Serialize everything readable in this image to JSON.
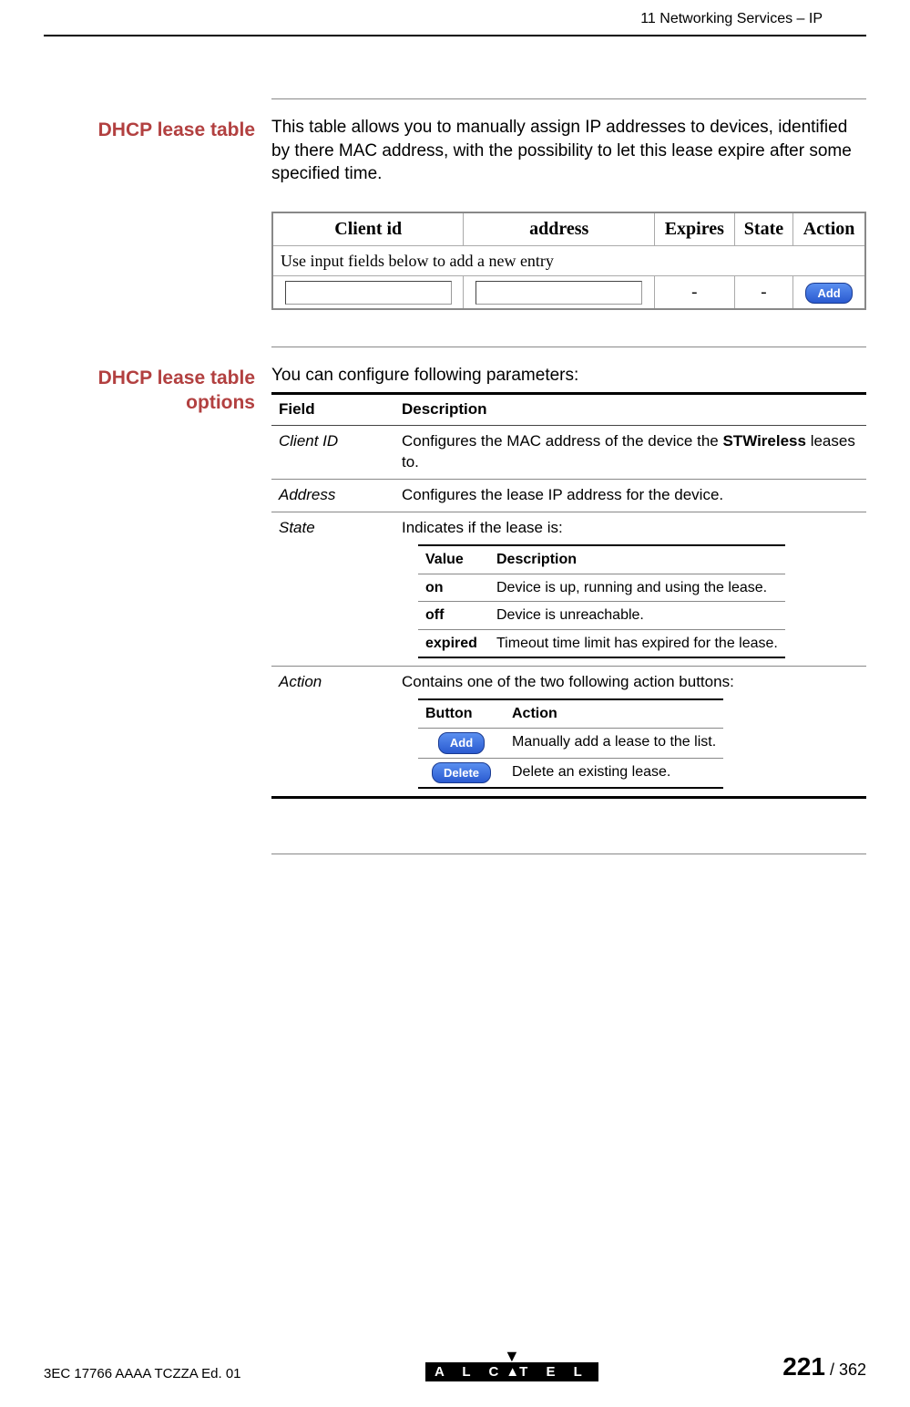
{
  "header": {
    "chapter": "11 Networking Services – IP"
  },
  "section1": {
    "heading": "DHCP lease table",
    "intro": "This table allows you to manually assign IP addresses to devices, identified by there MAC address, with the possibility to let this lease expire after some specified time."
  },
  "lease_table": {
    "columns": {
      "client_id": "Client id",
      "address": "address",
      "expires": "Expires",
      "state": "State",
      "action": "Action"
    },
    "hint_row": "Use input fields below to add a new entry",
    "dash": "-",
    "add_label": "Add"
  },
  "section2": {
    "heading": "DHCP lease table options",
    "intro": "You can configure following parameters:"
  },
  "opts": {
    "head_field": "Field",
    "head_desc": "Description",
    "rows": {
      "client_id": {
        "field": "Client ID",
        "desc_pre": "Configures the MAC address of the device the ",
        "desc_bold": "STWireless",
        "desc_post": " leases to."
      },
      "address": {
        "field": "Address",
        "desc": "Configures the lease IP address for the device."
      },
      "state": {
        "field": "State",
        "desc": "Indicates if the lease is:",
        "sub_head_value": "Value",
        "sub_head_desc": "Description",
        "sub": {
          "on": {
            "val": "on",
            "desc": "Device is up, running and using the lease."
          },
          "off": {
            "val": "off",
            "desc": "Device is unreachable."
          },
          "expired": {
            "val": "expired",
            "desc": "Timeout time limit has expired for the lease."
          }
        }
      },
      "action": {
        "field": "Action",
        "desc": "Contains one of the two following action buttons:",
        "sub_head_button": "Button",
        "sub_head_action": "Action",
        "sub": {
          "add": {
            "btn": "Add",
            "desc": "Manually add a lease to the list."
          },
          "delete": {
            "btn": "Delete",
            "desc": "Delete an existing lease."
          }
        }
      }
    }
  },
  "footer": {
    "doc_ref": "3EC 17766 AAAA TCZZA Ed. 01",
    "logo": "A L C A T E L",
    "page_current": "221",
    "page_sep": " / ",
    "page_total": "362"
  }
}
